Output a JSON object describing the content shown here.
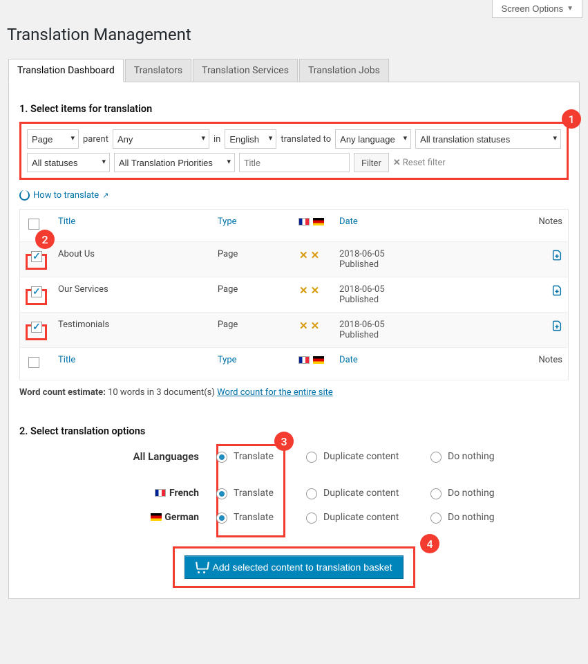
{
  "screen_options": "Screen Options",
  "page_title": "Translation Management",
  "tabs": [
    "Translation Dashboard",
    "Translators",
    "Translation Services",
    "Translation Jobs"
  ],
  "section1_title": "1. Select items for translation",
  "filters": {
    "type": "Page",
    "parent_label": "parent",
    "parent_value": "Any",
    "in_label": "in",
    "lang_from": "English",
    "translated_to_label": "translated to",
    "lang_to": "Any language",
    "translation_status": "All translation statuses",
    "status": "All statuses",
    "priority": "All Translation Priorities",
    "title_placeholder": "Title",
    "filter_btn": "Filter",
    "reset": "Reset filter"
  },
  "how_link": "How to translate",
  "table": {
    "headers": {
      "title": "Title",
      "type": "Type",
      "date": "Date",
      "notes": "Notes"
    },
    "rows": [
      {
        "title": "About Us",
        "type": "Page",
        "date": "2018-06-05",
        "status": "Published"
      },
      {
        "title": "Our Services",
        "type": "Page",
        "date": "2018-06-05",
        "status": "Published"
      },
      {
        "title": "Testimonials",
        "type": "Page",
        "date": "2018-06-05",
        "status": "Published"
      }
    ]
  },
  "word_count": {
    "label": "Word count estimate:",
    "text": "10 words in 3 document(s)",
    "link": "Word count for the entire site"
  },
  "section2_title": "2. Select translation options",
  "options": {
    "all_label": "All Languages",
    "translate": "Translate",
    "duplicate": "Duplicate content",
    "nothing": "Do nothing",
    "french": "French",
    "german": "German"
  },
  "basket_btn": "Add selected content to translation basket",
  "annotations": {
    "a1": "1",
    "a2": "2",
    "a3": "3",
    "a4": "4"
  }
}
